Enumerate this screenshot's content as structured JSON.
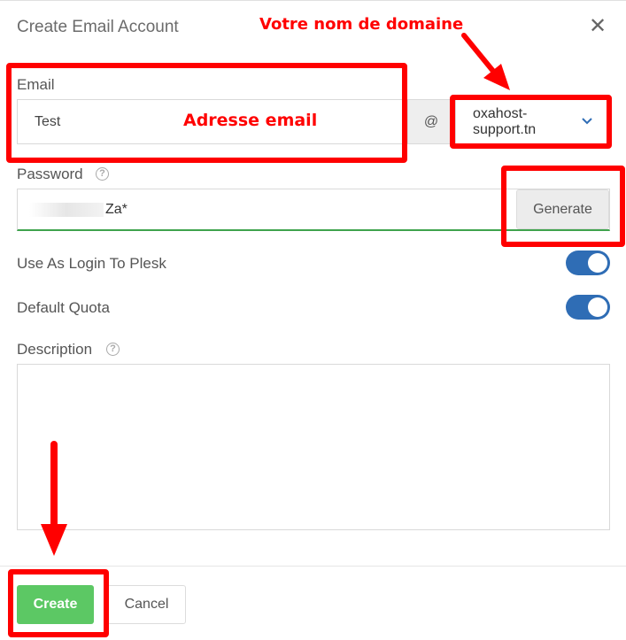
{
  "dialog": {
    "title": "Create Email Account"
  },
  "email": {
    "label": "Email",
    "value": "Test",
    "at": "@",
    "domain_line1": "oxahost-",
    "domain_line2": "support.tn"
  },
  "password": {
    "label": "Password",
    "value": "Za*",
    "generate_label": "Generate"
  },
  "toggles": {
    "login_label": "Use As Login To Plesk",
    "quota_label": "Default Quota"
  },
  "description": {
    "label": "Description",
    "value": ""
  },
  "footer": {
    "create_label": "Create",
    "cancel_label": "Cancel"
  },
  "annotations": {
    "domain_note": "Votre nom de domaine",
    "email_note": "Adresse email"
  },
  "colors": {
    "toggle_on": "#2f6db5",
    "create_button": "#5cc864",
    "annotation_red": "#ff0000",
    "password_valid": "#3fa34d"
  },
  "icons": {
    "close": "close-icon",
    "help": "help-icon",
    "dropdown": "chevron-down-icon"
  }
}
